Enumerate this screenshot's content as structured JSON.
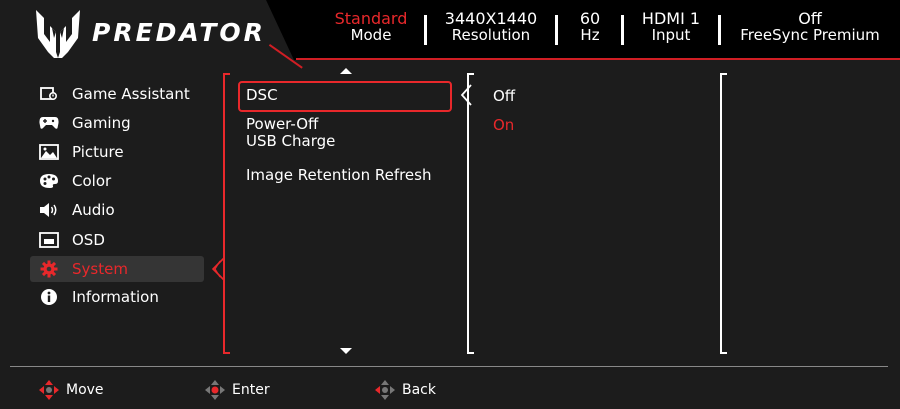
{
  "brand": "PREDATOR",
  "header": {
    "mode": {
      "value": "Standard",
      "label": "Mode"
    },
    "resolution": {
      "value": "3440X1440",
      "label": "Resolution"
    },
    "refresh": {
      "value": "60",
      "label": "Hz"
    },
    "input": {
      "value": "HDMI 1",
      "label": "Input"
    },
    "freesync": {
      "value": "Off",
      "label": "FreeSync Premium"
    }
  },
  "menu": [
    {
      "label": "Game Assistant",
      "icon": "game-assistant-icon"
    },
    {
      "label": "Gaming",
      "icon": "gamepad-icon"
    },
    {
      "label": "Picture",
      "icon": "picture-icon"
    },
    {
      "label": "Color",
      "icon": "palette-icon"
    },
    {
      "label": "Audio",
      "icon": "speaker-icon"
    },
    {
      "label": "OSD",
      "icon": "osd-icon"
    },
    {
      "label": "System",
      "icon": "gear-icon",
      "active": true
    },
    {
      "label": "Information",
      "icon": "info-icon"
    }
  ],
  "options": {
    "dsc": "DSC",
    "power_off_line1": "Power-Off",
    "power_off_line2": "USB Charge",
    "image_retention": "Image Retention Refresh"
  },
  "values": {
    "off": "Off",
    "on": "On"
  },
  "footer": {
    "move": "Move",
    "enter": "Enter",
    "back": "Back"
  },
  "colors": {
    "accent": "#e8282b",
    "background": "#1c1c1c",
    "header_background": "#000000"
  }
}
